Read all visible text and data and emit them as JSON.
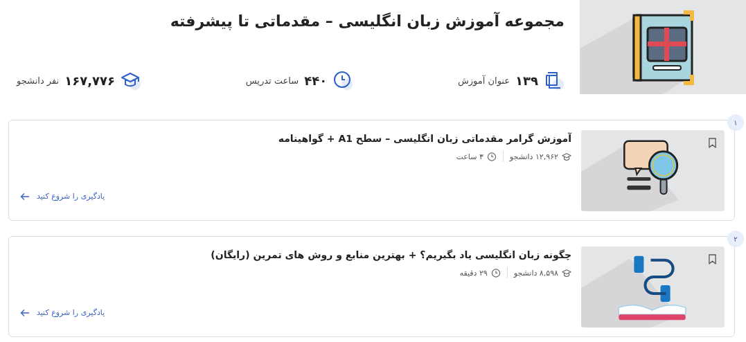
{
  "collection": {
    "title": "مجموعه آموزش زبان انگلیسی – مقدماتی تا پیشرفته",
    "stats": [
      {
        "kind": "courses",
        "value": "۱۳۹",
        "label": "عنوان آموزش"
      },
      {
        "kind": "hours",
        "value": "۴۴۰",
        "label": "ساعت تدریس"
      },
      {
        "kind": "students",
        "value": "۱۶۷,۷۷۶",
        "label": "نفر دانشجو"
      }
    ]
  },
  "courses": [
    {
      "index": "۱",
      "title": "آموزش گرامر مقدماتی زبان انگلیسی – سطح A1 + گواهینامه",
      "students": "۱۲,۹۶۲ دانشجو",
      "duration": "۳ ساعت",
      "link": "یادگیری را شروع کنید"
    },
    {
      "index": "۲",
      "title": "چگونه زبان انگلیسی یاد بگیریم؟ + بهترین منابع و روش های تمرین (رایگان)",
      "students": "۸,۵۹۸ دانشجو",
      "duration": "۲۹ دقیقه",
      "link": "یادگیری را شروع کنید"
    }
  ]
}
